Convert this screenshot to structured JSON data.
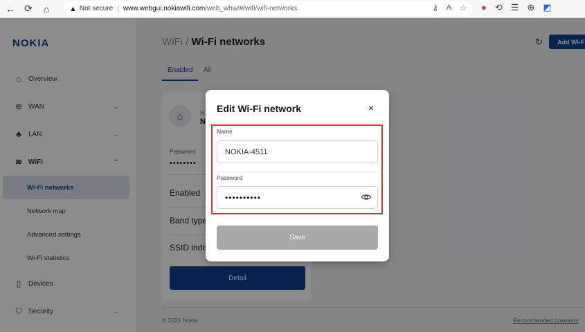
{
  "browser": {
    "not_secure": "Not secure",
    "url_host": "www.webgui.nokiawifi.com",
    "url_path": "/web_whw/#/wifi/wifi-networks"
  },
  "sidebar": {
    "logo": "NOKIA",
    "items": [
      {
        "label": "Overview"
      },
      {
        "label": "WAN"
      },
      {
        "label": "LAN"
      },
      {
        "label": "WiFi"
      },
      {
        "label": "Devices"
      },
      {
        "label": "Security"
      }
    ],
    "wifi_sub": [
      {
        "label": "Wi-Fi networks"
      },
      {
        "label": "Network map"
      },
      {
        "label": "Advanced settings"
      },
      {
        "label": "Wi-Fi statistics"
      }
    ]
  },
  "main": {
    "crumb": "WiFi / ",
    "title": "Wi-Fi networks",
    "add_button": "Add Wi-F",
    "tabs": [
      {
        "label": "Enabled"
      },
      {
        "label": "All"
      }
    ],
    "card": {
      "header_small": "H",
      "header_name": "N",
      "password_label": "Password",
      "password_value": "••••••••",
      "enabled_label": "Enabled",
      "band_label": "Band type",
      "ssid_label": "SSID index",
      "detail_button": "Detail"
    },
    "copyright": "© 2021 Nokia",
    "recommended": "Recommended browsers"
  },
  "modal": {
    "title": "Edit Wi-Fi network",
    "close": "×",
    "name_label": "Name",
    "name_value": "NOKIA-4511",
    "password_label": "Password",
    "password_value": "••••••••••",
    "save_button": "Save"
  },
  "colors": {
    "brand": "#124191",
    "highlight": "#d9333f",
    "save_disabled": "#a9a9a9"
  }
}
